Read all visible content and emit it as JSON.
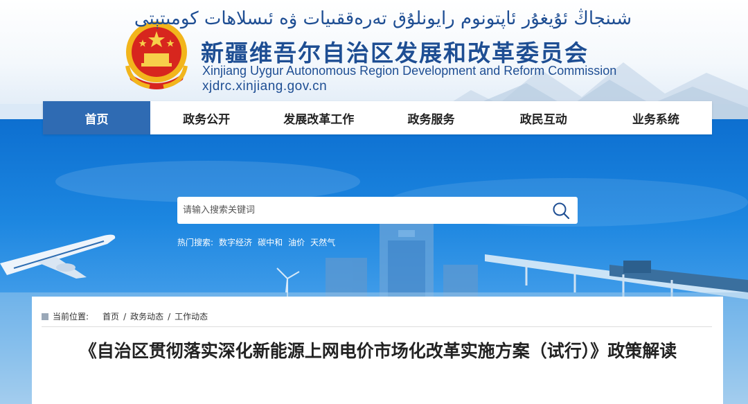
{
  "header": {
    "uyghur_title": "شىنجاڭ ئۇيغۇر ئاپتونوم رايونلۇق تەرەققىيات ۋە ئىسلاھات كومىتېتى",
    "chinese_title": "新疆维吾尔自治区发展和改革委员会",
    "english_title": "Xinjiang Uygur Autonomous Region Development and Reform Commission",
    "domain": "xjdrc.xinjiang.gov.cn"
  },
  "nav": {
    "items": [
      {
        "label": "首页"
      },
      {
        "label": "政务公开"
      },
      {
        "label": "发展改革工作"
      },
      {
        "label": "政务服务"
      },
      {
        "label": "政民互动"
      },
      {
        "label": "业务系统"
      }
    ]
  },
  "search": {
    "placeholder": "请输入搜索关键词",
    "hot_label": "热门搜索:",
    "hot_keywords": [
      "数字经济",
      "碳中和",
      "油价",
      "天然气"
    ]
  },
  "breadcrumb": {
    "label": "当前位置:",
    "items": [
      "首页",
      "政务动态",
      "工作动态"
    ]
  },
  "article": {
    "title": "《自治区贯彻落实深化新能源上网电价市场化改革实施方案（试行）》政策解读"
  },
  "colors": {
    "brand_blue": "#1e4e93",
    "nav_active": "#2f6bb3",
    "banner_blue": "#1c86e0"
  }
}
